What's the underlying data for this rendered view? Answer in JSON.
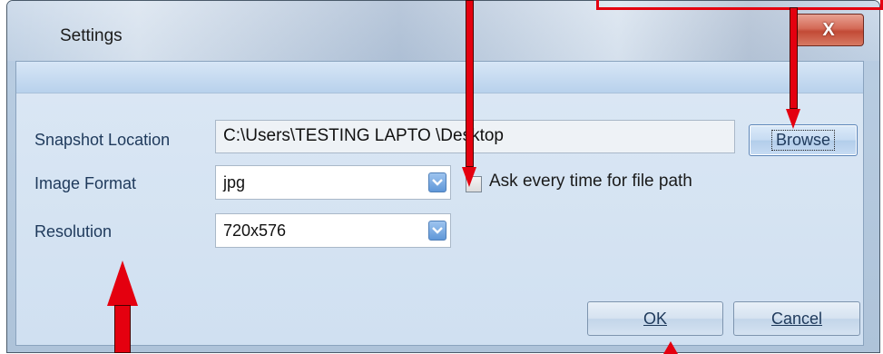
{
  "window": {
    "title": "Settings",
    "close_label": "X"
  },
  "form": {
    "snapshot_location": {
      "label": "Snapshot Location",
      "value": "C:\\Users\\TESTING LAPTO \\Desktop",
      "browse_label": "Browse"
    },
    "image_format": {
      "label": "Image Format",
      "value": "jpg",
      "ask_checkbox_label": "Ask every time for file path",
      "ask_checked": false
    },
    "resolution": {
      "label": "Resolution",
      "value": "720x576"
    }
  },
  "buttons": {
    "ok_label": "OK",
    "cancel_label": "Cancel"
  },
  "annotation_color": "#e4000f"
}
